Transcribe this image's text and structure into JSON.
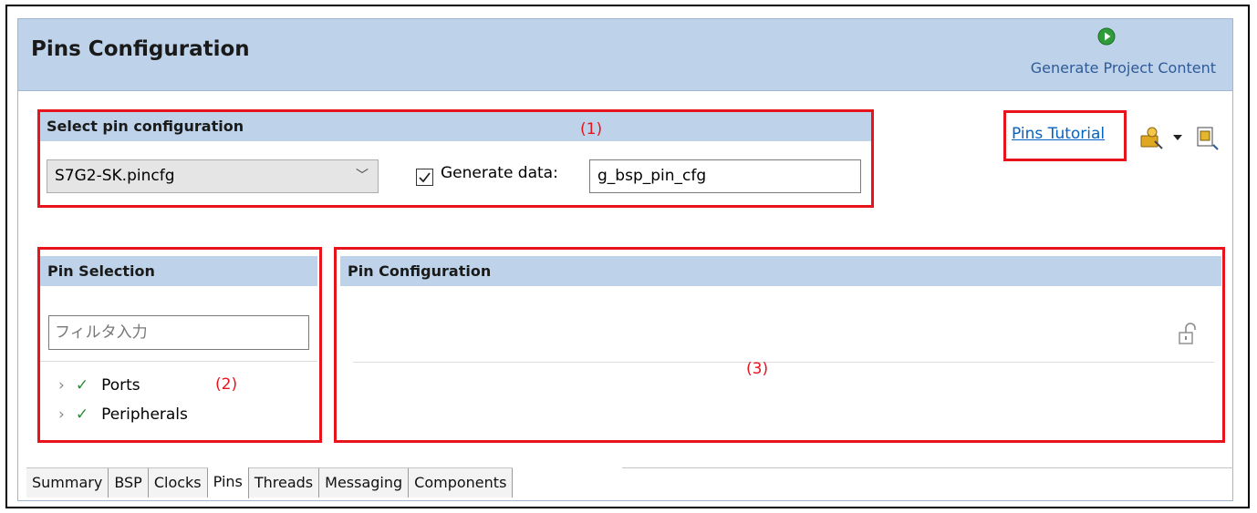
{
  "editor": {
    "title": "Pins Configuration",
    "generate_button_label": "Generate Project Content"
  },
  "select_config": {
    "heading": "Select pin configuration",
    "file": "S7G2-SK.pincfg",
    "generate_data_label": "Generate data:",
    "generate_data_checked": true,
    "data_name": "g_bsp_pin_cfg"
  },
  "toolbar": {
    "tutorial_link": "Pins Tutorial"
  },
  "pin_selection": {
    "heading": "Pin Selection",
    "filter_placeholder": "フィルタ入力",
    "tree": [
      "Ports",
      "Peripherals"
    ]
  },
  "pin_configuration": {
    "heading": "Pin Configuration"
  },
  "annotations": [
    "(1)",
    "(2)",
    "(3)"
  ],
  "tabs": [
    "Summary",
    "BSP",
    "Clocks",
    "Pins",
    "Threads",
    "Messaging",
    "Components"
  ],
  "active_tab": "Pins",
  "colors": {
    "header_bg": "#bed3ea",
    "annotation_red": "#e8141c",
    "link_blue": "#0563c1",
    "check_green": "#2e8b3c"
  }
}
